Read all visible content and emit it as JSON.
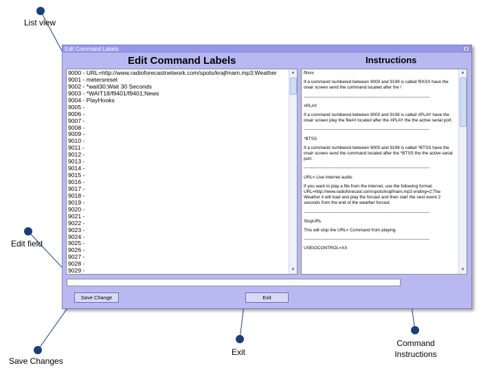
{
  "callouts": {
    "list_view": "List view",
    "edit_field": "Edit field",
    "save_changes": "Save Changes",
    "exit": "Exit",
    "command_instructions_line1": "Command",
    "command_instructions_line2": "Instructions"
  },
  "window": {
    "title": "Edit Command Labels",
    "close_glyph": "x",
    "heading_left": "Edit Command Labels",
    "heading_right": "Instructions"
  },
  "list_items": [
    "9000 - URL=http://www.radioforecastnetwork.com/spots/krajfmam.mp3;Weather",
    "9001 - metersreset",
    "9002 - *wait30;Wait 30 Seconds",
    "9003 - *WAIT18/f9401/f9401;News",
    "9004 - PlayHooks",
    "9005 -",
    "9006 -",
    "9007 -",
    "9008 -",
    "9009 -",
    "9010 -",
    "9011 -",
    "9012 -",
    "9013 -",
    "9014 -",
    "9015 -",
    "9016 -",
    "9017 -",
    "9018 -",
    "9019 -",
    "9020 -",
    "9021 -",
    "9022 -",
    "9023 -",
    "9024 -",
    "9025 -",
    "9026 -",
    "9027 -",
    "9028 -",
    "9029 -"
  ],
  "instructions": [
    {
      "kind": "text",
      "text": "f9xxx"
    },
    {
      "kind": "text",
      "text": "If a command numbered between 9000 and 9199 is called f9XXX have the onair screen send the command located after the !"
    },
    {
      "kind": "sep",
      "text": "--------------------------------------------------------------------------------------"
    },
    {
      "kind": "text",
      "text": "#PLAY"
    },
    {
      "kind": "text",
      "text": "If a command numbered between 9000 and 9199 is called #PLAY have the onair screen play the file## located after the #PLAY the the active serial port."
    },
    {
      "kind": "sep",
      "text": "--------------------------------------------------------------------------------------"
    },
    {
      "kind": "text",
      "text": "*BTSS"
    },
    {
      "kind": "text",
      "text": "If a command numbered between 9000 and 9199 is called *BTSS have the onair screen send the command located after the *BTSS the the active serial port."
    },
    {
      "kind": "sep",
      "text": "--------------------------------------------------------------------------------------"
    },
    {
      "kind": "text",
      "text": "URL= Live internet audio"
    },
    {
      "kind": "text",
      "text": "If you want to play a file from the internet, use the following format: URL=http://www.radioforecast.com/spots/krajfmam.mp3 ending=2;The Weather it will load and play the forcast and then start the next event 2 seconds from the end of the weather forcast."
    },
    {
      "kind": "sep",
      "text": "--------------------------------------------------------------------------------------"
    },
    {
      "kind": "text",
      "text": "StopURL"
    },
    {
      "kind": "text",
      "text": "This will stop the URL= Command from playing."
    },
    {
      "kind": "sep",
      "text": "--------------------------------------------------------------------------------------"
    },
    {
      "kind": "text",
      "text": "USEIOCONTROL=XX"
    }
  ],
  "edit_field": {
    "value": "",
    "placeholder": ""
  },
  "buttons": {
    "save": "Save Change",
    "exit": "Exit"
  },
  "icons": {
    "scroll_up": "scroll-up-arrow-icon",
    "scroll_down": "scroll-down-arrow-icon",
    "callout_marker": "callout-dot-icon"
  },
  "colors": {
    "window_bg": "#b9b9f2",
    "titlebar": "#9797e8",
    "callout": "#1a3f7a"
  }
}
